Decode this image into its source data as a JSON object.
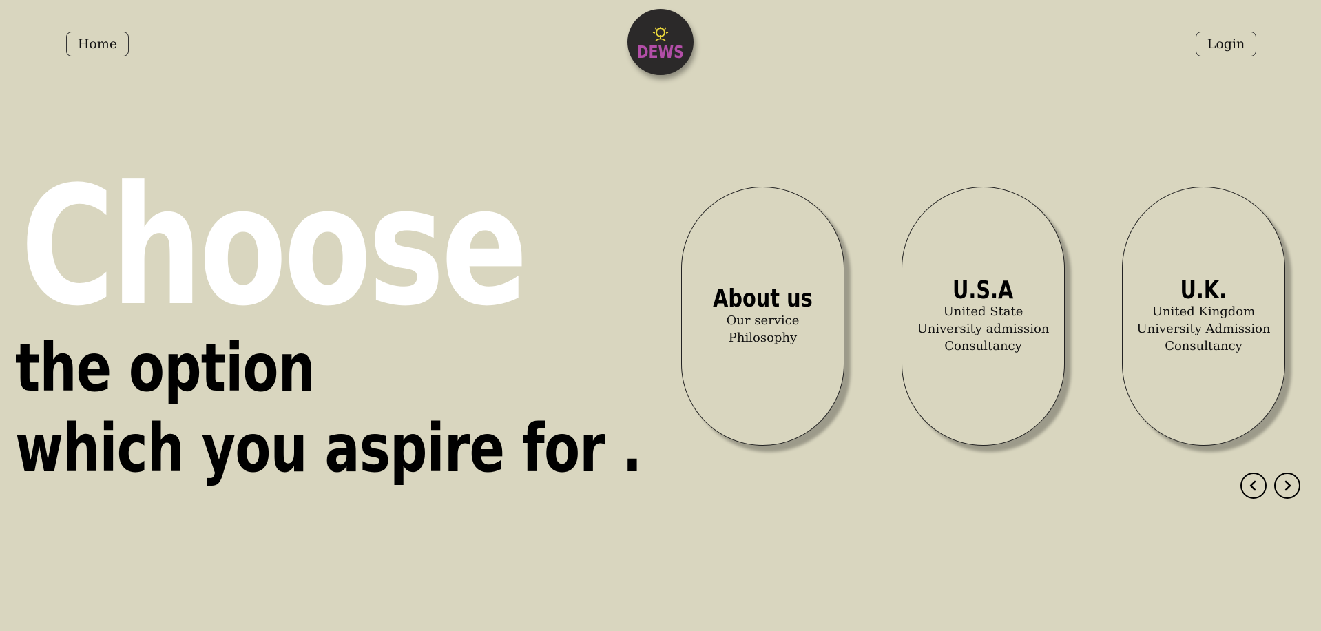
{
  "nav": {
    "home_label": "Home",
    "login_label": "Login"
  },
  "logo": {
    "text": "DEWS",
    "icon": "tree-icon",
    "text_color": "#b24ea7",
    "tree_color": "#e7d43b",
    "background": "#2b2929"
  },
  "hero": {
    "line1": "Choose",
    "line2": "the option",
    "line3": "which you aspire for ."
  },
  "cards": [
    {
      "title": "About us",
      "lines": [
        "Our service",
        "Philosophy"
      ]
    },
    {
      "title": "U.S.A",
      "lines": [
        "United State",
        "University admission",
        "Consultancy"
      ]
    },
    {
      "title": "U.K.",
      "lines": [
        "United Kingdom",
        "University Admission",
        "Consultancy"
      ]
    }
  ],
  "carousel": {
    "prev_icon": "chevron-left-icon",
    "next_icon": "chevron-right-icon"
  },
  "colors": {
    "background": "#d9d6bf",
    "hero_highlight": "#ffffff",
    "text": "#000000"
  }
}
